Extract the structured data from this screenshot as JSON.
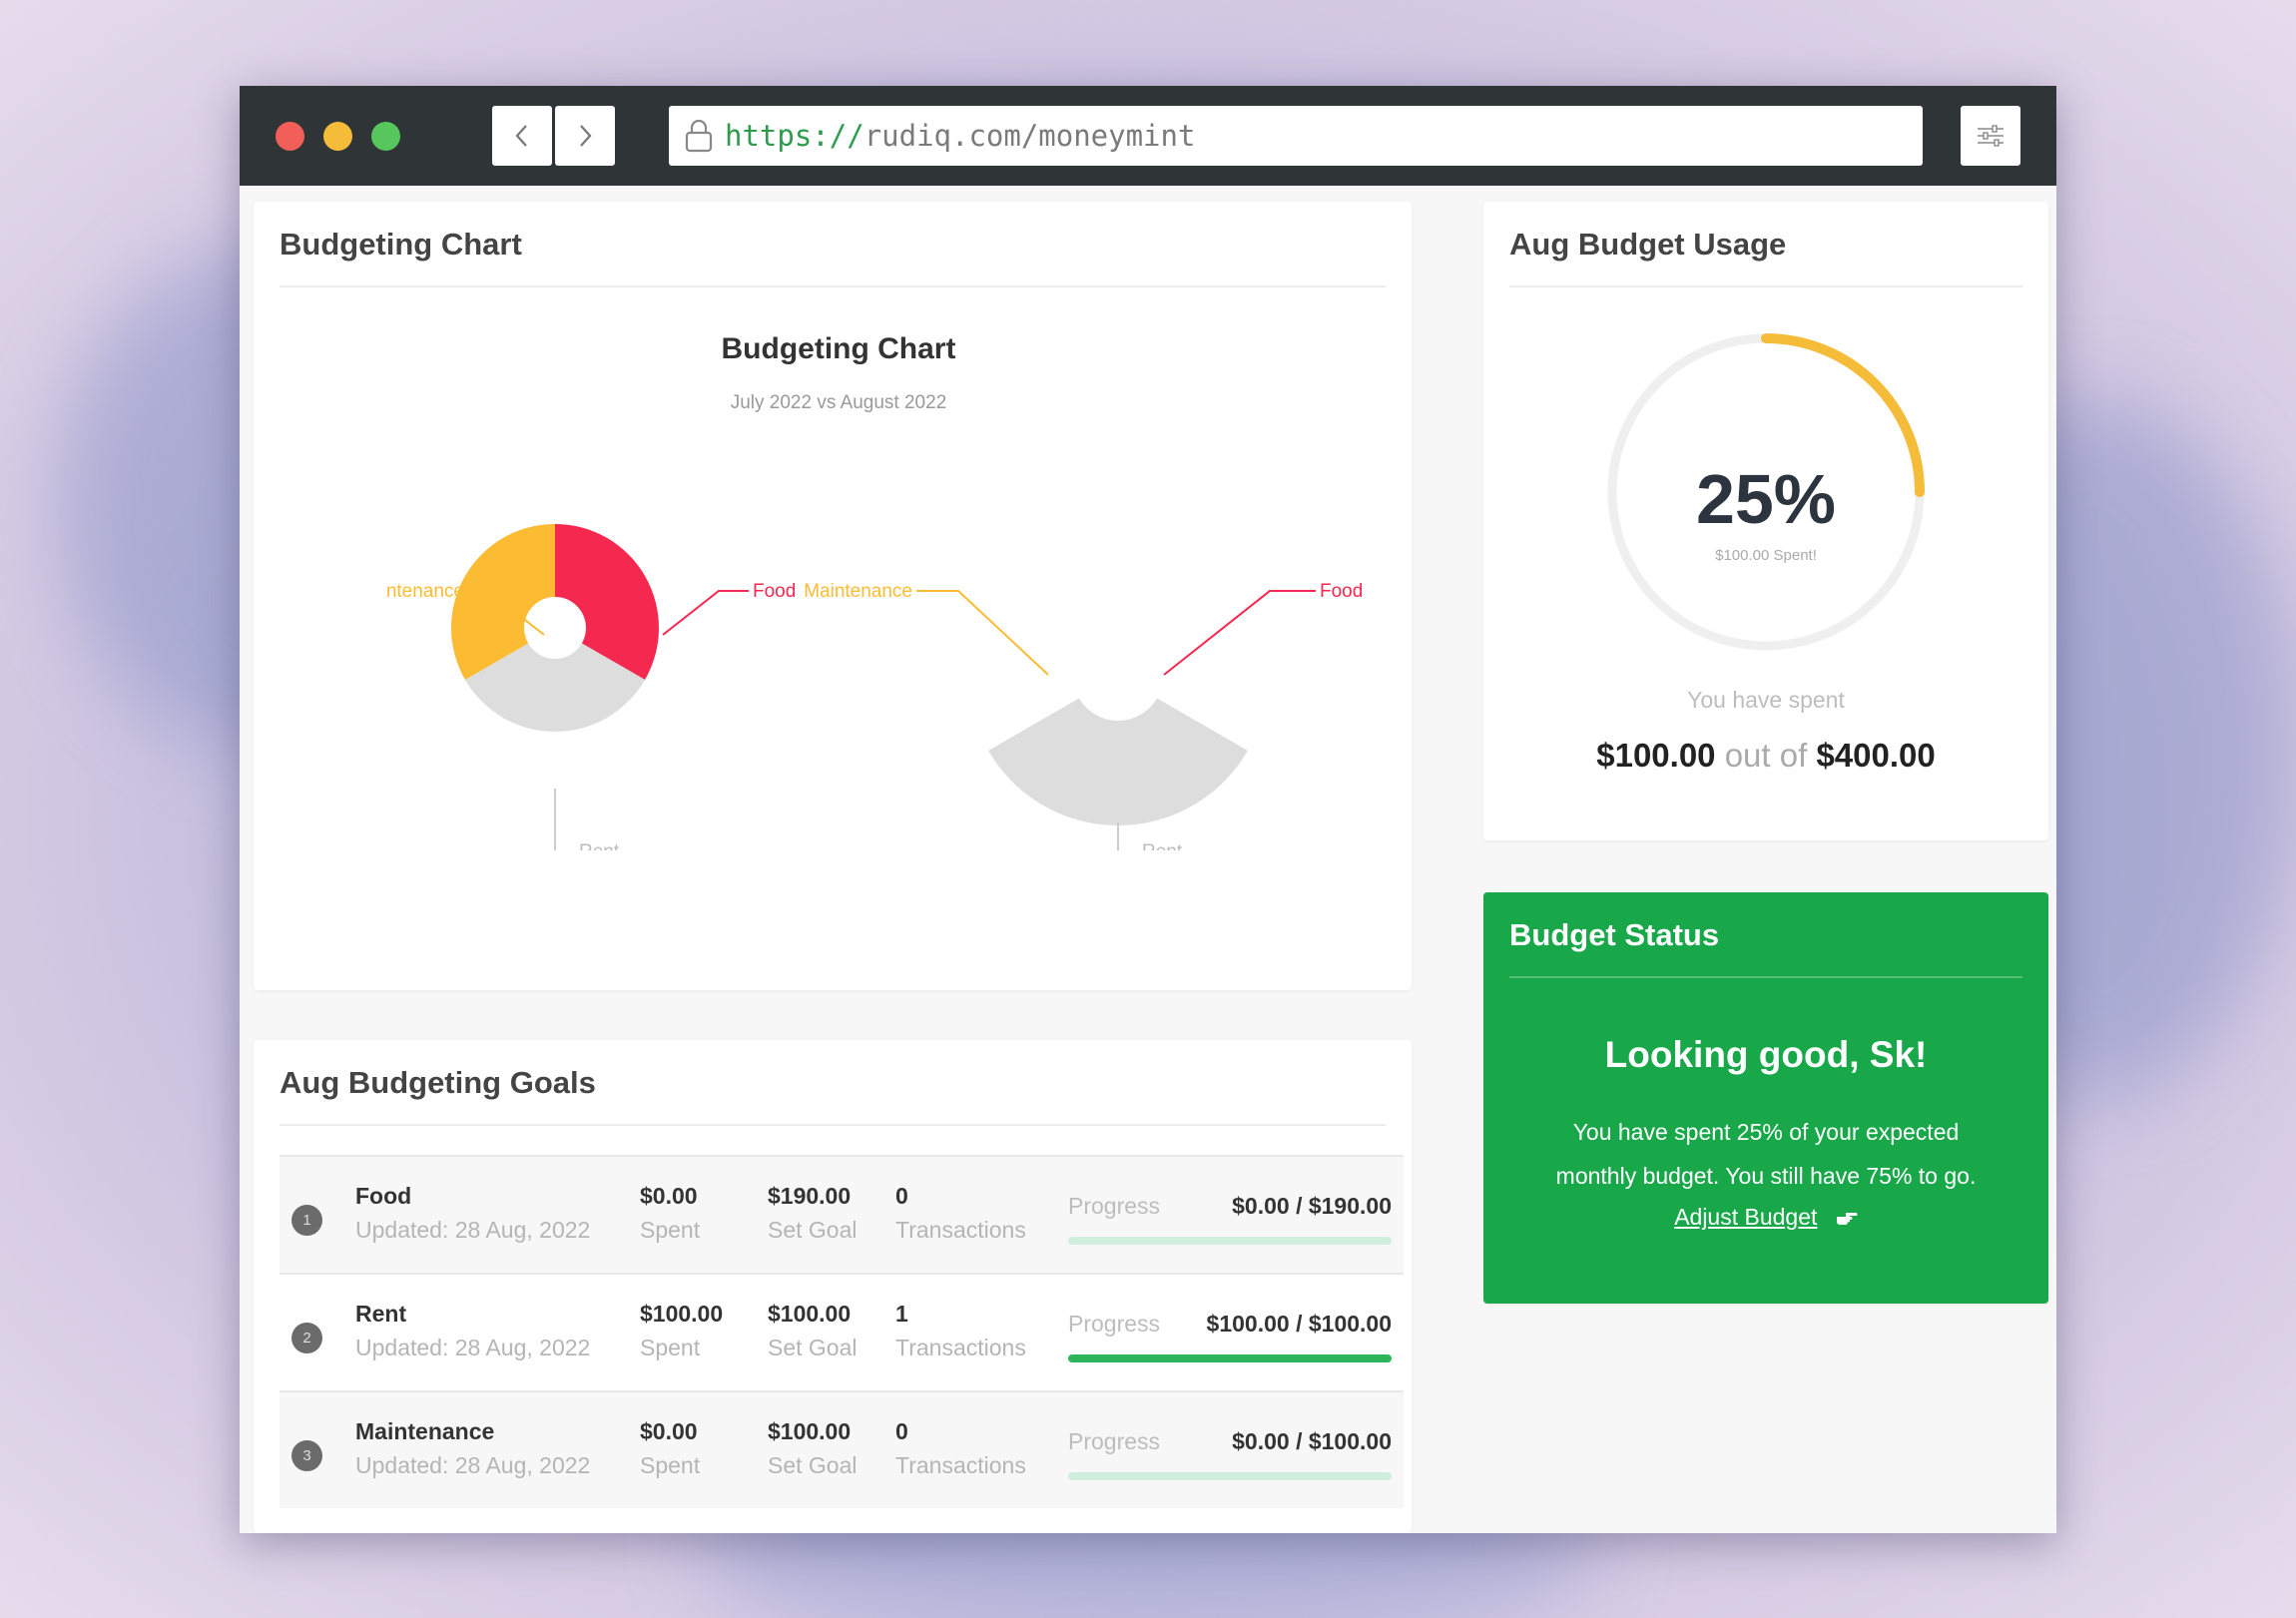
{
  "browser": {
    "url_protocol": "https://",
    "url_rest": "rudiq.com/moneymint",
    "back_icon": "chevron-left-icon",
    "forward_icon": "chevron-right-icon",
    "menu_icon": "sliders-icon"
  },
  "chart_card": {
    "title": "Budgeting Chart"
  },
  "chart_data": {
    "type": "pie",
    "title": "Budgeting Chart",
    "subtitle": "July 2022 vs August 2022",
    "charts": [
      {
        "slices": [
          {
            "label": "Food",
            "value": 33.3,
            "color": "#f5284f"
          },
          {
            "label": "Rent",
            "value": 33.3,
            "color": "#dddddd"
          },
          {
            "label": "Maintenance",
            "value": 33.3,
            "color": "#fbbb32"
          }
        ],
        "labels_text": {
          "left": "ntenance",
          "right": "Food",
          "bottom": "Rent"
        }
      },
      {
        "slices": [
          {
            "label": "Food",
            "value": 0,
            "color": "#f5284f"
          },
          {
            "label": "Rent",
            "value": 100,
            "color": "#dddddd"
          },
          {
            "label": "Maintenance",
            "value": 0,
            "color": "#fbbb32"
          }
        ],
        "labels_text": {
          "left": "Maintenance",
          "right": "Food",
          "bottom": "Rent"
        }
      }
    ]
  },
  "usage_card": {
    "title": "Aug Budget Usage",
    "percent_text": "25%",
    "percent_value": 25,
    "spent_sub": "$100.00 Spent!",
    "you_have_spent": "You have spent",
    "spent_amount": "$100.00",
    "out_of": "out of",
    "total_amount": "$400.00",
    "ring_color": "#f5bc3a"
  },
  "status_card": {
    "title": "Budget Status",
    "headline": "Looking good, Sk!",
    "message": "You have spent 25% of your expected monthly budget. You still have 75% to go.",
    "link_label": "Adjust Budget",
    "link_icon": "hand-pointing-icon",
    "color": "#18a84a"
  },
  "goals_card": {
    "title": "Aug Budgeting Goals",
    "progress_label": "Progress",
    "rows": [
      {
        "num": "1",
        "name": "Food",
        "updated": "Updated: 28 Aug, 2022",
        "spent": "$0.00",
        "spent_label": "Spent",
        "goal": "$190.00",
        "goal_label": "Set Goal",
        "tx": "0",
        "tx_label": "Transactions",
        "progress_text": "$0.00 / $190.00",
        "progress": 0
      },
      {
        "num": "2",
        "name": "Rent",
        "updated": "Updated: 28 Aug, 2022",
        "spent": "$100.00",
        "spent_label": "Spent",
        "goal": "$100.00",
        "goal_label": "Set Goal",
        "tx": "1",
        "tx_label": "Transactions",
        "progress_text": "$100.00 / $100.00",
        "progress": 1
      },
      {
        "num": "3",
        "name": "Maintenance",
        "updated": "Updated: 28 Aug, 2022",
        "spent": "$0.00",
        "spent_label": "Spent",
        "goal": "$100.00",
        "goal_label": "Set Goal",
        "tx": "0",
        "tx_label": "Transactions",
        "progress_text": "$0.00 / $100.00",
        "progress": 0
      }
    ]
  }
}
